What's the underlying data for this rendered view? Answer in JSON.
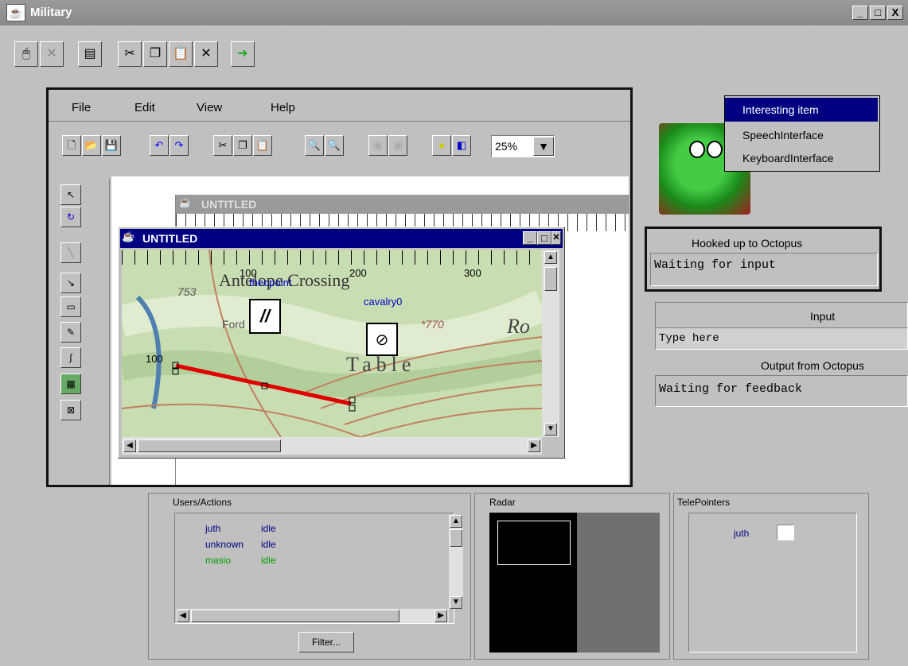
{
  "window": {
    "title": "Military",
    "minimize": "_",
    "restore": "□",
    "close": "X"
  },
  "toolbar": {
    "icons": [
      "cursor-icon",
      "cross-icon",
      "properties-icon",
      "cut-icon",
      "copy-icon",
      "paste-icon",
      "delete-icon",
      "exit-icon"
    ]
  },
  "editor": {
    "menu": [
      "File",
      "Edit",
      "View",
      "Help"
    ],
    "zoom": "25%",
    "doc_title": "UNTITLED",
    "map_window_title": "UNTITLED",
    "ruler": [
      "100",
      "200",
      "300"
    ],
    "map_labels": {
      "place": "Antelope Crossing",
      "overlay": "theopoint",
      "unit": "cavalry0",
      "elev1": "753",
      "elev2": "*770",
      "ford": "Ford",
      "table": "Table",
      "ro": "Ro",
      "y100": "100"
    }
  },
  "popup": {
    "items": [
      "Interesting item",
      "SpeechInterface",
      "KeyboardInterface"
    ]
  },
  "octopus": {
    "status_title": "Hooked up to Octopus",
    "status_text": "Waiting for input",
    "input_label": "Input",
    "input_placeholder": "Type here",
    "output_label": "Output from Octopus",
    "output_text": "Waiting for feedback"
  },
  "users": {
    "title": "Users/Actions",
    "rows": [
      {
        "name": "juth",
        "action": "idle",
        "color": "#000080"
      },
      {
        "name": "unknown",
        "action": "idle",
        "color": "#000080"
      },
      {
        "name": "masio",
        "action": "idle",
        "color": "#00a000"
      }
    ],
    "filter_label": "Filter..."
  },
  "radar": {
    "title": "Radar"
  },
  "telepointers": {
    "title": "TelePointers",
    "user": "juth"
  },
  "colors": {
    "title_blue": "#000080",
    "route_red": "#e00000"
  }
}
